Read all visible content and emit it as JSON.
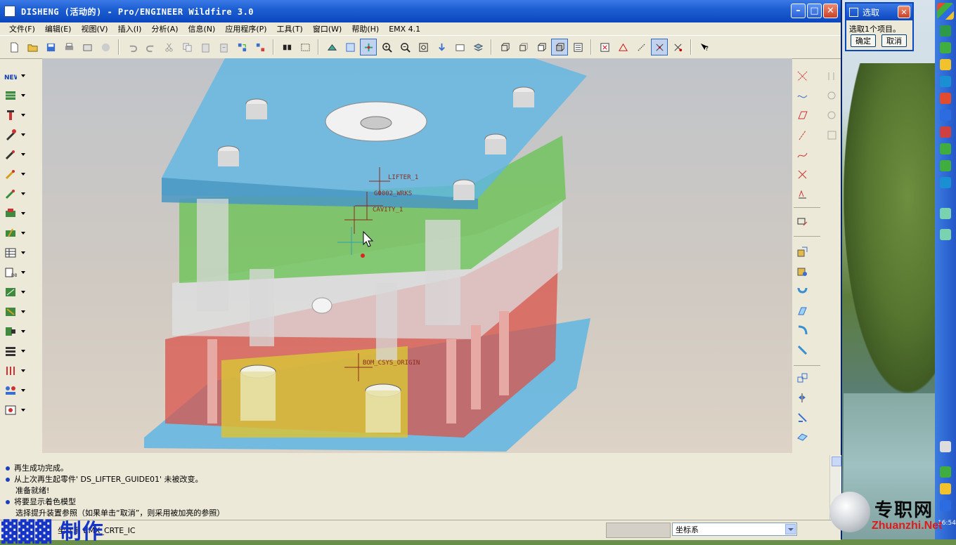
{
  "window": {
    "title": "DISHENG (活动的) - Pro/ENGINEER Wildfire 3.0",
    "controls": [
      "minimize",
      "maximize",
      "close"
    ]
  },
  "menu": [
    {
      "label": "文件(F)"
    },
    {
      "label": "编辑(E)"
    },
    {
      "label": "视图(V)"
    },
    {
      "label": "插入(I)"
    },
    {
      "label": "分析(A)"
    },
    {
      "label": "信息(N)"
    },
    {
      "label": "应用程序(P)"
    },
    {
      "label": "工具(T)"
    },
    {
      "label": "窗口(W)"
    },
    {
      "label": "帮助(H)"
    },
    {
      "label": "EMX 4.1"
    }
  ],
  "toolbar_icons": [
    "new-file-icon",
    "open-folder-icon",
    "save-icon",
    "print-icon",
    "send-mail-icon",
    "disabled-icon",
    "undo-icon",
    "redo-icon",
    "cut-icon",
    "copy-icon",
    "paste-icon",
    "paste-special-icon",
    "regenerate-icon",
    "regenerate-manager-icon",
    "find-icon",
    "select-box-icon",
    "repaint-icon",
    "orient-icon",
    "spin-center-icon",
    "zoom-in-icon",
    "zoom-out-icon",
    "refit-icon",
    "view-manager-icon",
    "saved-views-icon",
    "layers-icon",
    "wireframe-icon",
    "hidden-line-icon",
    "no-hidden-icon",
    "shading-icon",
    "model-tree-icon",
    "datum-plane-toggle-icon",
    "datum-axis-toggle-icon",
    "datum-point-toggle-icon",
    "csys-toggle-icon",
    "what-is-this-icon"
  ],
  "graphics": {
    "annotations": {
      "lifter": "LIFTER_1",
      "workpiece": "G0002_WRKS",
      "cavity": "CAVITY_1",
      "csys": "BOM_CSYS_ORIGIN"
    },
    "colors": {
      "top_plate": "#5fb6e3",
      "cavity_plate": "#66c24f",
      "core_plate": "#c8cfd4",
      "support_plate": "#d9534a",
      "ejector_plate": "#d8c23a",
      "bottom_plate": "#5fb6e3"
    }
  },
  "messages": [
    {
      "text": "再生成功完成。",
      "bullet": true
    },
    {
      "text": "从上次再生起零件' DS_LIFTER_GUIDE01' 未被改变。",
      "bullet": true
    },
    {
      "text": "准备就绪!",
      "bullet": false
    },
    {
      "text": "将要显示着色模型",
      "bullet": true
    },
    {
      "text": "选择提升装置参照（如果单击“取消”，则采用被加亮的参照）",
      "bullet": false
    }
  ],
  "statusbar": {
    "status": "坐标系 EMX_CRTE_IC",
    "filter": "坐标系"
  },
  "select_dialog": {
    "title": "选取",
    "message": "选取1个项目。",
    "ok": "确定",
    "cancel": "取消"
  },
  "watermark": {
    "left": "制作",
    "site_cn": "专职网",
    "site_en": "Zhuanzhi.Net"
  },
  "clock": "16:54"
}
